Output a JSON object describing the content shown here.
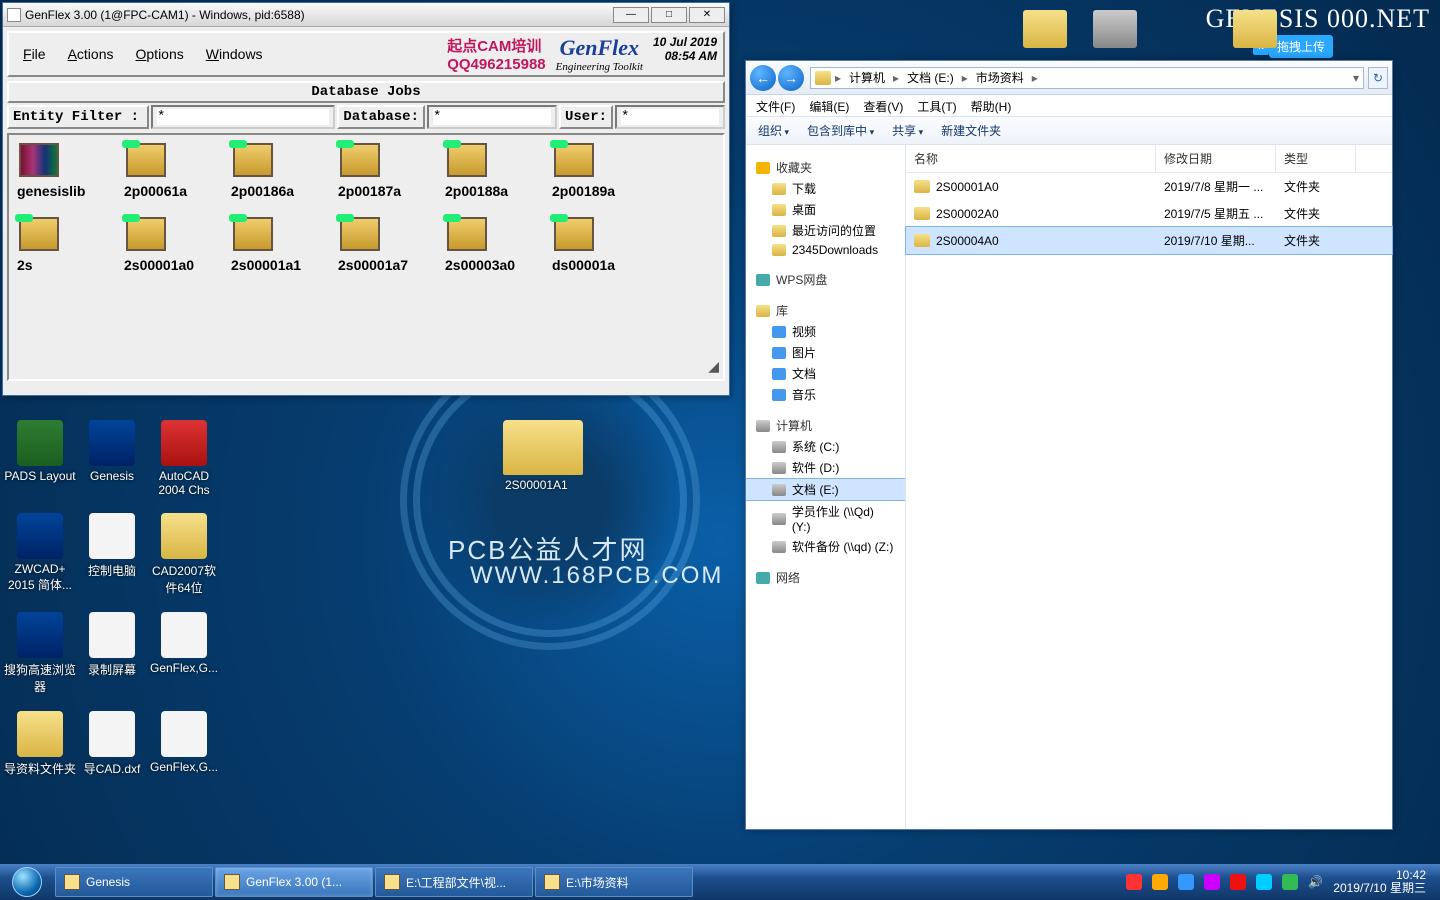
{
  "bg": {
    "center_label": "2S00001A1",
    "line1": "PCB公益人才网",
    "line2": "WWW.168PCB.COM",
    "brand": "GENESIS      000.NET",
    "upload": "拖拽上传"
  },
  "top_desk": [
    {
      "label": ""
    },
    {
      "label": ""
    },
    {
      "label": ""
    }
  ],
  "genflex": {
    "title": "GenFlex 3.00 (1@FPC-CAM1) - Windows, pid:6588)",
    "menus": [
      "File",
      "Actions",
      "Options",
      "Windows"
    ],
    "brand_qd1": "起点CAM培训",
    "brand_qd2": "QQ496215988",
    "brand_name": "GenFlex",
    "brand_sub": "Engineering Toolkit",
    "brand_date": "10 Jul 2019",
    "brand_time": "08:54 AM",
    "dbhdr": "Database Jobs",
    "filter_lbl": "Entity Filter :",
    "filter_val": "*",
    "db_lbl": "Database:",
    "db_val": "*",
    "user_lbl": "User:",
    "user_val": "*",
    "jobs": [
      "genesislib",
      "2p00061a",
      "2p00186a",
      "2p00187a",
      "2p00188a",
      "2p00189a",
      "2s",
      "2s00001a0",
      "2s00001a1",
      "2s00001a7",
      "2s00003a0",
      "ds00001a"
    ]
  },
  "explorer": {
    "crumbs": [
      "计算机",
      "文档 (E:)",
      "市场资料"
    ],
    "menu": [
      "文件(F)",
      "编辑(E)",
      "查看(V)",
      "工具(T)",
      "帮助(H)"
    ],
    "toolbar": [
      "组织",
      "包含到库中",
      "共享",
      "新建文件夹"
    ],
    "side_fav_hdr": "收藏夹",
    "side_fav": [
      "下载",
      "桌面",
      "最近访问的位置",
      "2345Downloads"
    ],
    "side_wps": "WPS网盘",
    "side_lib_hdr": "库",
    "side_lib": [
      "视频",
      "图片",
      "文档",
      "音乐"
    ],
    "side_comp_hdr": "计算机",
    "side_comp": [
      "系统 (C:)",
      "软件 (D:)",
      "文档 (E:)",
      "学员作业 (\\\\Qd) (Y:)",
      "软件备份 (\\\\qd) (Z:)"
    ],
    "side_net": "网络",
    "cols": [
      "名称",
      "修改日期",
      "类型"
    ],
    "rows": [
      {
        "n": "2S00001A0",
        "d": "2019/7/8 星期一 ...",
        "t": "文件夹",
        "sel": false
      },
      {
        "n": "2S00002A0",
        "d": "2019/7/5 星期五 ...",
        "t": "文件夹",
        "sel": false
      },
      {
        "n": "2S00004A0",
        "d": "2019/7/10 星期...",
        "t": "文件夹",
        "sel": true
      }
    ]
  },
  "desktop_icons": [
    {
      "label": "PADS Layout",
      "cls": "app1"
    },
    {
      "label": "Genesis",
      "cls": "app2"
    },
    {
      "label": "AutoCAD 2004 Chs",
      "cls": "app3"
    },
    {
      "label": "ZWCAD+ 2015 简体...",
      "cls": "app2"
    },
    {
      "label": "控制电脑",
      "cls": "white"
    },
    {
      "label": "CAD2007软件64位",
      "cls": "folder"
    },
    {
      "label": "搜狗高速浏览器",
      "cls": "app2"
    },
    {
      "label": "录制屏幕",
      "cls": "white"
    },
    {
      "label": "GenFlex,G...",
      "cls": "white"
    },
    {
      "label": "导资料文件夹",
      "cls": "folder"
    },
    {
      "label": "导CAD.dxf",
      "cls": "white"
    },
    {
      "label": "GenFlex,G...",
      "cls": "white"
    }
  ],
  "taskbar": {
    "buttons": [
      {
        "label": "Genesis",
        "active": false
      },
      {
        "label": "GenFlex 3.00 (1...",
        "active": true
      },
      {
        "label": "E:\\工程部文件\\视...",
        "active": false
      },
      {
        "label": "E:\\市场资料",
        "active": false
      }
    ],
    "time": "10:42",
    "date": "2019/7/10 星期三"
  }
}
